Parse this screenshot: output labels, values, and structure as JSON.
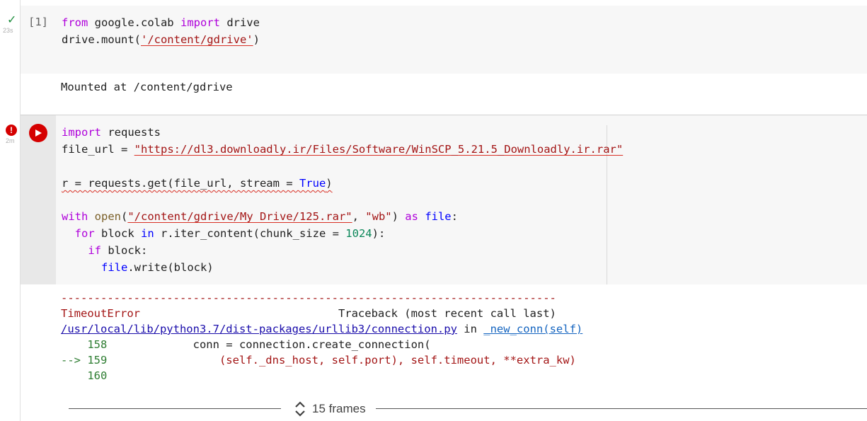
{
  "cell1": {
    "status_icon": "check-icon",
    "status_time": "23s",
    "exec_count": "[1]",
    "code": {
      "l1_kw1": "from",
      "l1_mod": " google.colab ",
      "l1_kw2": "import",
      "l1_rest": " drive",
      "l2_pre": "drive.mount(",
      "l2_str": "'/content/gdrive'",
      "l2_post": ")"
    },
    "output": "Mounted at /content/gdrive"
  },
  "cell2": {
    "status_icon": "error-icon",
    "status_mark": "!",
    "status_time": "2m",
    "run_icon": "play-icon",
    "code": {
      "l1_kw": "import",
      "l1_rest": " requests",
      "l2_pre": "file_url = ",
      "l2_str": "\"https://dl3.downloadly.ir/Files/Software/WinSCP_5.21.5_Downloadly.ir.rar\"",
      "l4_a": "r = requests.get(file_url, stream = ",
      "l4_true": "True",
      "l4_b": ")",
      "l6_kw": "with",
      "l6_sp": " ",
      "l6_fn": "open",
      "l6_p1": "(",
      "l6_str1": "\"/content/gdrive/My Drive/125.rar\"",
      "l6_p2": ", ",
      "l6_str2": "\"wb\"",
      "l6_p3": ") ",
      "l6_as": "as",
      "l6_sp2": " ",
      "l6_file": "file",
      "l6_end": ":",
      "l7_ind": "  ",
      "l7_for": "for",
      "l7_a": " block ",
      "l7_in": "in",
      "l7_b": " r.iter_content(chunk_size = ",
      "l7_num": "1024",
      "l7_c": "):",
      "l8_ind": "    ",
      "l8_if": "if",
      "l8_rest": " block:",
      "l9_ind": "      ",
      "l9_file": "file",
      "l9_rest": ".write(block)"
    },
    "output": {
      "dashes": "---------------------------------------------------------------------------",
      "error_name": "TimeoutError",
      "traceback_label": "                              Traceback (most recent call last)",
      "path_link": "/usr/local/lib/python3.7/dist-packages/urllib3/connection.py",
      "in_text": " in ",
      "func_link": "_new_conn(self)",
      "line158_no": "    158",
      "line158_code": "             conn = connection.create_connection(",
      "arrow": "--> ",
      "line159_no": "159",
      "line159_code": "                 (self._dns_host, self.port), self.timeout, **extra_kw)",
      "line160_no": "    160",
      "frames_icon": "unfold-icon",
      "frames_label": "15 frames"
    }
  }
}
